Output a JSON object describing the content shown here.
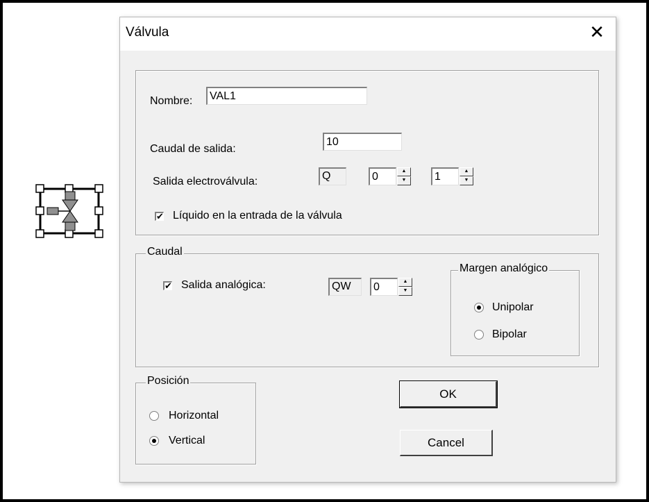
{
  "dialog": {
    "title": "Válvula",
    "close_glyph": "✕",
    "nombre": {
      "label": "Nombre:",
      "value": "VAL1"
    },
    "caudal_salida": {
      "label": "Caudal de salida:",
      "value": "10"
    },
    "salida_electrovalvula": {
      "label": "Salida electroválvula:",
      "prefix": "Q",
      "spin1_value": "0",
      "spin2_value": "1"
    },
    "liquido_check": {
      "label": "Líquido en la entrada de la válvula",
      "checked": true
    },
    "caudal_group": {
      "legend": "Caudal",
      "salida_analogica": {
        "label": "Salida analógica:",
        "checked": true
      },
      "prefix": "QW",
      "spin_value": "0",
      "margen": {
        "legend": "Margen analógico",
        "unipolar": "Unipolar",
        "bipolar": "Bipolar",
        "selected": "Unipolar"
      }
    },
    "posicion_group": {
      "legend": "Posición",
      "horizontal": "Horizontal",
      "vertical": "Vertical",
      "selected": "Vertical"
    },
    "ok_label": "OK",
    "cancel_label": "Cancel"
  },
  "checkmark_glyph": "✔",
  "colors": {
    "dialog_bg": "#f0f0f0",
    "valve_fill": "#909090"
  },
  "icons": [
    "valve-symbol-icon",
    "close-icon",
    "spin-up-icon",
    "spin-down-icon"
  ]
}
